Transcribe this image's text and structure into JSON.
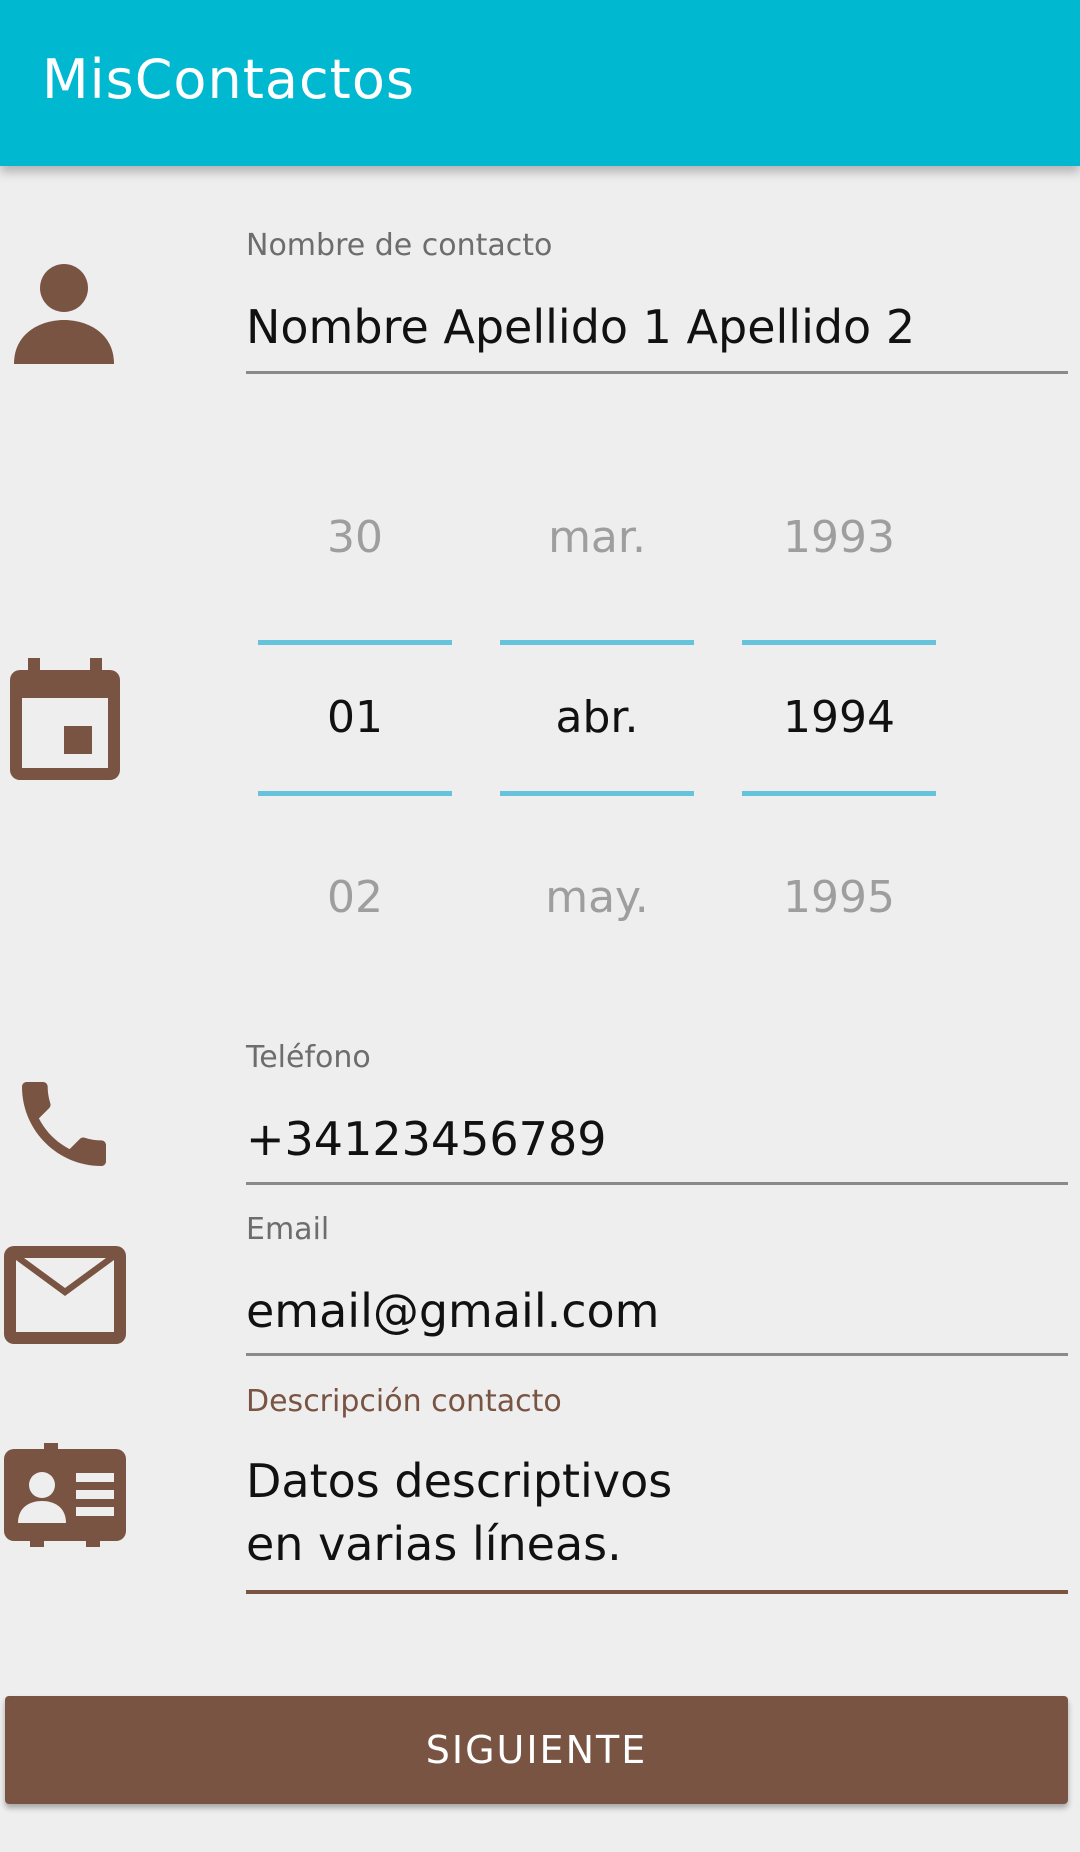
{
  "app": {
    "title": "MisContactos"
  },
  "name_field": {
    "label": "Nombre de contacto",
    "value": "Nombre Apellido 1 Apellido 2"
  },
  "date_picker": {
    "day": {
      "prev": "30",
      "selected": "01",
      "next": "02"
    },
    "month": {
      "prev": "mar.",
      "selected": "abr.",
      "next": "may."
    },
    "year": {
      "prev": "1993",
      "selected": "1994",
      "next": "1995"
    }
  },
  "phone_field": {
    "label": "Teléfono",
    "value": "+34123456789"
  },
  "email_field": {
    "label": "Email",
    "value": "email@gmail.com"
  },
  "description_field": {
    "label": "Descripción contacto",
    "value": "Datos descriptivos\nen varias líneas."
  },
  "next_button": {
    "label": "SIGUIENTE"
  },
  "colors": {
    "appbar": "#00b8d0",
    "accent": "#7a5443",
    "picker_divider": "#66c3dc",
    "background": "#eeeeee"
  },
  "icons": [
    "person-icon",
    "calendar-icon",
    "phone-icon",
    "email-icon",
    "contact-card-icon"
  ]
}
